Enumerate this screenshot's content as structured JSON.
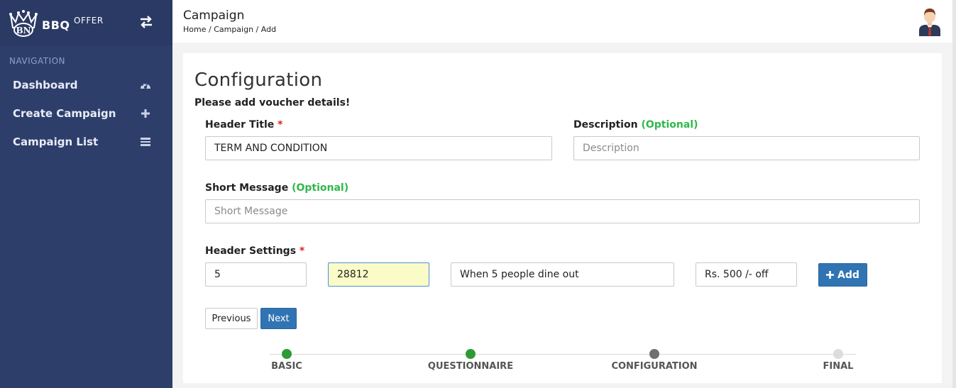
{
  "app": {
    "brand_name": "BBQ",
    "brand_sup": "OFFER",
    "logo_text": "BN"
  },
  "sidebar": {
    "heading": "NAVIGATION",
    "items": [
      {
        "label": "Dashboard",
        "icon": "dashboard-gauge-icon"
      },
      {
        "label": "Create Campaign",
        "icon": "plus-icon"
      },
      {
        "label": "Campaign List",
        "icon": "list-icon"
      }
    ]
  },
  "header": {
    "title": "Campaign",
    "breadcrumb": [
      "Home",
      "Campaign",
      "Add"
    ],
    "breadcrumb_sep": " / "
  },
  "form": {
    "title": "Configuration",
    "subtitle": "Please add voucher details!",
    "header_title": {
      "label": "Header Title",
      "required": "*",
      "value": "TERM AND CONDITION"
    },
    "description": {
      "label": "Description",
      "optional": "(Optional)",
      "placeholder": "Description",
      "value": ""
    },
    "short_message": {
      "label": "Short Message",
      "optional": "(Optional)",
      "placeholder": "Short Message",
      "value": ""
    },
    "header_settings": {
      "label": "Header Settings",
      "required": "*",
      "field1": "5",
      "field2": "28812",
      "field3": "When 5 people dine out",
      "field4": "Rs. 500 /- off",
      "add_label": "Add"
    },
    "previous_label": "Previous",
    "next_label": "Next"
  },
  "stepper": {
    "steps": [
      {
        "label": "BASIC",
        "status": "done",
        "color": "#2e9a34"
      },
      {
        "label": "QUESTIONNAIRE",
        "status": "done",
        "color": "#2e9a34"
      },
      {
        "label": "CONFIGURATION",
        "status": "active",
        "color": "#6f6f6f"
      },
      {
        "label": "FINAL",
        "status": "pending",
        "color": "#dddddd"
      }
    ]
  },
  "colors": {
    "sidebar_bg": "#2d3e6b",
    "primary": "#3074b3",
    "required": "#e02020",
    "optional": "#2fb84a"
  }
}
